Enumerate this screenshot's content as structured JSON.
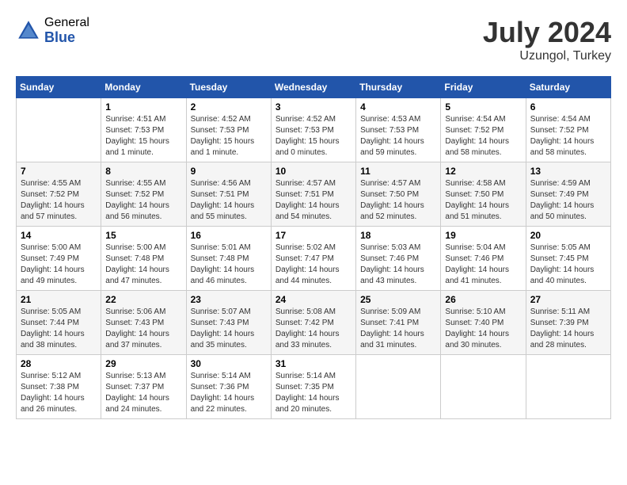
{
  "header": {
    "logo_general": "General",
    "logo_blue": "Blue",
    "month_year": "July 2024",
    "location": "Uzungol, Turkey"
  },
  "weekdays": [
    "Sunday",
    "Monday",
    "Tuesday",
    "Wednesday",
    "Thursday",
    "Friday",
    "Saturday"
  ],
  "weeks": [
    [
      {
        "day": "",
        "sunrise": "",
        "sunset": "",
        "daylight": ""
      },
      {
        "day": "1",
        "sunrise": "Sunrise: 4:51 AM",
        "sunset": "Sunset: 7:53 PM",
        "daylight": "Daylight: 15 hours and 1 minute."
      },
      {
        "day": "2",
        "sunrise": "Sunrise: 4:52 AM",
        "sunset": "Sunset: 7:53 PM",
        "daylight": "Daylight: 15 hours and 1 minute."
      },
      {
        "day": "3",
        "sunrise": "Sunrise: 4:52 AM",
        "sunset": "Sunset: 7:53 PM",
        "daylight": "Daylight: 15 hours and 0 minutes."
      },
      {
        "day": "4",
        "sunrise": "Sunrise: 4:53 AM",
        "sunset": "Sunset: 7:53 PM",
        "daylight": "Daylight: 14 hours and 59 minutes."
      },
      {
        "day": "5",
        "sunrise": "Sunrise: 4:54 AM",
        "sunset": "Sunset: 7:52 PM",
        "daylight": "Daylight: 14 hours and 58 minutes."
      },
      {
        "day": "6",
        "sunrise": "Sunrise: 4:54 AM",
        "sunset": "Sunset: 7:52 PM",
        "daylight": "Daylight: 14 hours and 58 minutes."
      }
    ],
    [
      {
        "day": "7",
        "sunrise": "Sunrise: 4:55 AM",
        "sunset": "Sunset: 7:52 PM",
        "daylight": "Daylight: 14 hours and 57 minutes."
      },
      {
        "day": "8",
        "sunrise": "Sunrise: 4:55 AM",
        "sunset": "Sunset: 7:52 PM",
        "daylight": "Daylight: 14 hours and 56 minutes."
      },
      {
        "day": "9",
        "sunrise": "Sunrise: 4:56 AM",
        "sunset": "Sunset: 7:51 PM",
        "daylight": "Daylight: 14 hours and 55 minutes."
      },
      {
        "day": "10",
        "sunrise": "Sunrise: 4:57 AM",
        "sunset": "Sunset: 7:51 PM",
        "daylight": "Daylight: 14 hours and 54 minutes."
      },
      {
        "day": "11",
        "sunrise": "Sunrise: 4:57 AM",
        "sunset": "Sunset: 7:50 PM",
        "daylight": "Daylight: 14 hours and 52 minutes."
      },
      {
        "day": "12",
        "sunrise": "Sunrise: 4:58 AM",
        "sunset": "Sunset: 7:50 PM",
        "daylight": "Daylight: 14 hours and 51 minutes."
      },
      {
        "day": "13",
        "sunrise": "Sunrise: 4:59 AM",
        "sunset": "Sunset: 7:49 PM",
        "daylight": "Daylight: 14 hours and 50 minutes."
      }
    ],
    [
      {
        "day": "14",
        "sunrise": "Sunrise: 5:00 AM",
        "sunset": "Sunset: 7:49 PM",
        "daylight": "Daylight: 14 hours and 49 minutes."
      },
      {
        "day": "15",
        "sunrise": "Sunrise: 5:00 AM",
        "sunset": "Sunset: 7:48 PM",
        "daylight": "Daylight: 14 hours and 47 minutes."
      },
      {
        "day": "16",
        "sunrise": "Sunrise: 5:01 AM",
        "sunset": "Sunset: 7:48 PM",
        "daylight": "Daylight: 14 hours and 46 minutes."
      },
      {
        "day": "17",
        "sunrise": "Sunrise: 5:02 AM",
        "sunset": "Sunset: 7:47 PM",
        "daylight": "Daylight: 14 hours and 44 minutes."
      },
      {
        "day": "18",
        "sunrise": "Sunrise: 5:03 AM",
        "sunset": "Sunset: 7:46 PM",
        "daylight": "Daylight: 14 hours and 43 minutes."
      },
      {
        "day": "19",
        "sunrise": "Sunrise: 5:04 AM",
        "sunset": "Sunset: 7:46 PM",
        "daylight": "Daylight: 14 hours and 41 minutes."
      },
      {
        "day": "20",
        "sunrise": "Sunrise: 5:05 AM",
        "sunset": "Sunset: 7:45 PM",
        "daylight": "Daylight: 14 hours and 40 minutes."
      }
    ],
    [
      {
        "day": "21",
        "sunrise": "Sunrise: 5:05 AM",
        "sunset": "Sunset: 7:44 PM",
        "daylight": "Daylight: 14 hours and 38 minutes."
      },
      {
        "day": "22",
        "sunrise": "Sunrise: 5:06 AM",
        "sunset": "Sunset: 7:43 PM",
        "daylight": "Daylight: 14 hours and 37 minutes."
      },
      {
        "day": "23",
        "sunrise": "Sunrise: 5:07 AM",
        "sunset": "Sunset: 7:43 PM",
        "daylight": "Daylight: 14 hours and 35 minutes."
      },
      {
        "day": "24",
        "sunrise": "Sunrise: 5:08 AM",
        "sunset": "Sunset: 7:42 PM",
        "daylight": "Daylight: 14 hours and 33 minutes."
      },
      {
        "day": "25",
        "sunrise": "Sunrise: 5:09 AM",
        "sunset": "Sunset: 7:41 PM",
        "daylight": "Daylight: 14 hours and 31 minutes."
      },
      {
        "day": "26",
        "sunrise": "Sunrise: 5:10 AM",
        "sunset": "Sunset: 7:40 PM",
        "daylight": "Daylight: 14 hours and 30 minutes."
      },
      {
        "day": "27",
        "sunrise": "Sunrise: 5:11 AM",
        "sunset": "Sunset: 7:39 PM",
        "daylight": "Daylight: 14 hours and 28 minutes."
      }
    ],
    [
      {
        "day": "28",
        "sunrise": "Sunrise: 5:12 AM",
        "sunset": "Sunset: 7:38 PM",
        "daylight": "Daylight: 14 hours and 26 minutes."
      },
      {
        "day": "29",
        "sunrise": "Sunrise: 5:13 AM",
        "sunset": "Sunset: 7:37 PM",
        "daylight": "Daylight: 14 hours and 24 minutes."
      },
      {
        "day": "30",
        "sunrise": "Sunrise: 5:14 AM",
        "sunset": "Sunset: 7:36 PM",
        "daylight": "Daylight: 14 hours and 22 minutes."
      },
      {
        "day": "31",
        "sunrise": "Sunrise: 5:14 AM",
        "sunset": "Sunset: 7:35 PM",
        "daylight": "Daylight: 14 hours and 20 minutes."
      },
      {
        "day": "",
        "sunrise": "",
        "sunset": "",
        "daylight": ""
      },
      {
        "day": "",
        "sunrise": "",
        "sunset": "",
        "daylight": ""
      },
      {
        "day": "",
        "sunrise": "",
        "sunset": "",
        "daylight": ""
      }
    ]
  ]
}
